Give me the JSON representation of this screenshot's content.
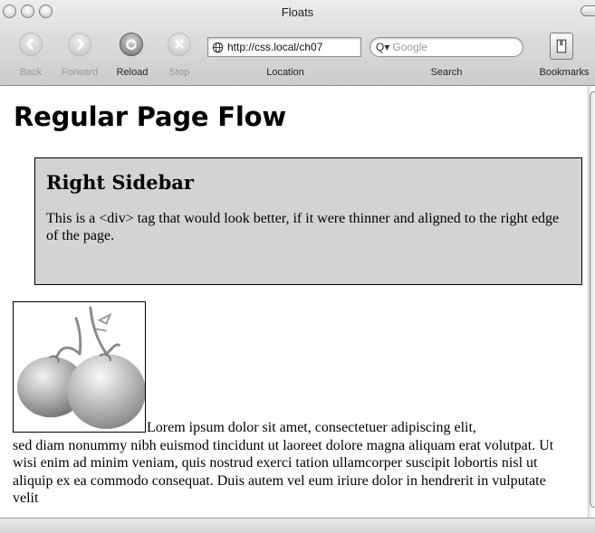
{
  "window": {
    "title": "Floats"
  },
  "toolbar": {
    "back_label": "Back",
    "forward_label": "Forward",
    "reload_label": "Reload",
    "stop_label": "Stop",
    "location_label": "Location",
    "search_label": "Search",
    "bookmarks_label": "Bookmarks",
    "url_value": "http://css.local/ch07",
    "search_placeholder": "Google"
  },
  "page": {
    "heading": "Regular Page Flow",
    "sidebar": {
      "title": "Right Sidebar",
      "text": "This is a <div> tag that would look better, if it were thinner and aligned to the right edge of the page."
    },
    "image": {
      "alt": "tomatoes"
    },
    "body_first_line": "Lorem ipsum dolor sit amet, consectetuer adipiscing elit,",
    "body_rest": "sed diam nonummy nibh euismod tincidunt ut laoreet dolore magna aliquam erat volutpat. Ut wisi enim ad minim veniam, quis nostrud exerci tation ullamcorper suscipit lobortis nisl ut aliquip ex ea commodo consequat. Duis autem vel eum iriure dolor in hendrerit in vulputate velit"
  },
  "icons": {
    "back": "back-arrow-icon",
    "forward": "forward-arrow-icon",
    "reload": "reload-icon",
    "stop": "stop-x-icon",
    "bookmarks": "book-icon",
    "location": "globe-icon",
    "search": "magnifier-icon"
  }
}
